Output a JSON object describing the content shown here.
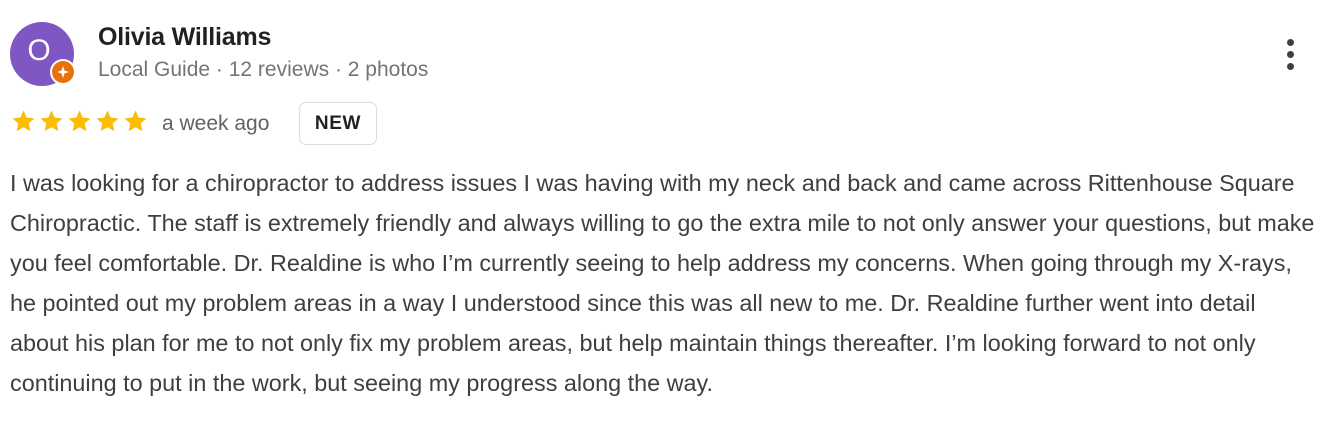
{
  "review": {
    "author": {
      "initial": "O",
      "name": "Olivia Williams",
      "meta": "Local Guide · 12 reviews · 2 photos",
      "avatar_color": "#7e57c2",
      "badge_icon": "local-guide-star-icon",
      "badge_color": "#e8710a"
    },
    "more_icon": "more-vert-icon",
    "rating": 5,
    "rating_max": 5,
    "star_color": "#fbbc04",
    "date": "a week ago",
    "new_badge": "NEW",
    "text": "I was looking for a chiropractor to address issues I was having with my neck and back and came across Rittenhouse Square Chiropractic. The staff is extremely friendly and always willing to go the extra mile to not only answer your questions, but make you feel comfortable. Dr. Realdine is who I’m currently seeing to help address my concerns. When going through my X-rays, he pointed out my problem areas in a way I understood since this was all new to me. Dr. Realdine further went into detail about his plan for me to not only fix my problem areas, but help maintain things thereafter. I’m looking forward to not only continuing to put in the work, but seeing my progress along the way."
  }
}
